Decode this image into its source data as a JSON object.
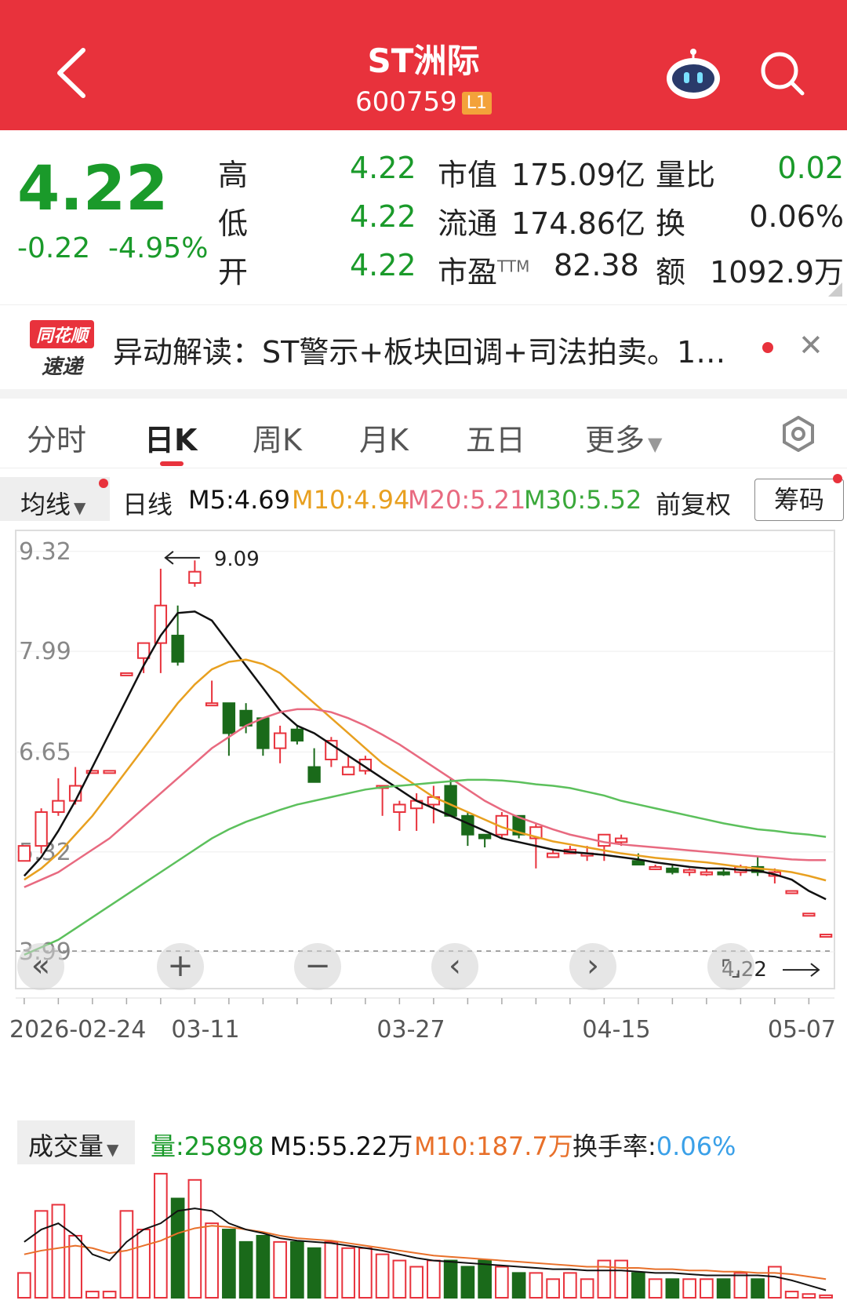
{
  "header": {
    "title": "ST洲际",
    "code": "600759",
    "level": "L1"
  },
  "quote": {
    "price": "4.22",
    "change": "-0.22",
    "change_pct": "-4.95%",
    "rows": [
      {
        "l1": "高",
        "v1": "4.22",
        "l2": "市值",
        "v2": "175.09亿",
        "l3": "量比",
        "v3": "0.02"
      },
      {
        "l1": "低",
        "v1": "4.22",
        "l2": "流通",
        "v2": "174.86亿",
        "l3": "换",
        "v3": "0.06%"
      },
      {
        "l1": "开",
        "v1": "4.22",
        "l2": "市盈TTM",
        "v2": "82.38",
        "l3": "额",
        "v3": "1092.9万"
      }
    ]
  },
  "alert": {
    "logo_top": "同花顺",
    "logo_bottom": "速递",
    "text": "异动解读：ST警示+板块回调+司法拍卖。1…"
  },
  "tabs": [
    "分时",
    "日K",
    "周K",
    "月K",
    "五日",
    "更多"
  ],
  "ma_bar": {
    "selector": "均线",
    "line": "日线",
    "m5": "M5:4.69",
    "m10": "M10:4.94",
    "m20": "M20:5.21",
    "m30": "M30:5.52",
    "adjust": "前复权",
    "chips": "筹码"
  },
  "colors": {
    "up": "#e8323c",
    "down": "#1a6a1a",
    "ma5": "#111111",
    "ma10": "#e8a020",
    "ma20": "#e86a80",
    "ma30": "#5cc05c",
    "brand": "#e8323c",
    "ratio": "#3aa0e8"
  },
  "chart_data": {
    "type": "candlestick",
    "y_ticks": [
      "9.32",
      "7.99",
      "6.65",
      "5.32",
      "3.99"
    ],
    "x_labels": [
      "2026-02-24",
      "03-11",
      "03-27",
      "04-15",
      "05-07"
    ],
    "high_label": "9.09",
    "low_label": "4.22",
    "ylim": [
      3.5,
      9.6
    ],
    "candles": [
      [
        5.2,
        5.4,
        5.2,
        5.4
      ],
      [
        5.4,
        5.9,
        5.3,
        5.85
      ],
      [
        5.85,
        6.3,
        5.8,
        6.0
      ],
      [
        6.0,
        6.45,
        5.95,
        6.2
      ],
      [
        6.4,
        6.4,
        6.4,
        6.4
      ],
      [
        6.4,
        6.4,
        6.4,
        6.4
      ],
      [
        7.7,
        7.7,
        7.7,
        7.7
      ],
      [
        7.9,
        8.1,
        7.7,
        8.1
      ],
      [
        8.1,
        9.09,
        7.7,
        8.6
      ],
      [
        8.2,
        8.6,
        7.8,
        7.85
      ],
      [
        8.9,
        9.2,
        8.85,
        9.05
      ],
      [
        7.3,
        7.6,
        7.3,
        7.3
      ],
      [
        7.3,
        7.3,
        6.6,
        6.9
      ],
      [
        7.2,
        7.3,
        6.9,
        7.0
      ],
      [
        7.1,
        7.1,
        6.6,
        6.7
      ],
      [
        6.7,
        7.0,
        6.5,
        6.9
      ],
      [
        6.95,
        7.0,
        6.75,
        6.8
      ],
      [
        6.45,
        6.7,
        6.35,
        6.25
      ],
      [
        6.55,
        6.85,
        6.45,
        6.8
      ],
      [
        6.35,
        6.6,
        6.4,
        6.45
      ],
      [
        6.4,
        6.6,
        6.35,
        6.55
      ],
      [
        6.2,
        6.2,
        5.8,
        6.2
      ],
      [
        5.85,
        6.0,
        5.6,
        5.95
      ],
      [
        5.9,
        6.1,
        5.6,
        6.0
      ],
      [
        5.95,
        6.2,
        5.7,
        6.05
      ],
      [
        6.2,
        6.3,
        5.85,
        5.8
      ],
      [
        5.8,
        5.85,
        5.4,
        5.55
      ],
      [
        5.55,
        5.5,
        5.38,
        5.5
      ],
      [
        5.55,
        5.85,
        5.5,
        5.8
      ],
      [
        5.8,
        5.8,
        5.5,
        5.55
      ],
      [
        5.5,
        5.7,
        5.1,
        5.65
      ],
      [
        5.25,
        5.35,
        5.3,
        5.3
      ],
      [
        5.3,
        5.4,
        5.3,
        5.35
      ],
      [
        5.3,
        5.4,
        5.2,
        5.3
      ],
      [
        5.4,
        5.55,
        5.2,
        5.55
      ],
      [
        5.45,
        5.55,
        5.4,
        5.5
      ],
      [
        5.2,
        5.3,
        5.15,
        5.15
      ],
      [
        5.1,
        5.15,
        5.08,
        5.12
      ],
      [
        5.1,
        5.15,
        5.02,
        5.05
      ],
      [
        5.05,
        5.1,
        5.0,
        5.08
      ],
      [
        5.05,
        5.1,
        5.0,
        5.05
      ],
      [
        5.05,
        5.1,
        5.0,
        5.02
      ],
      [
        5.05,
        5.15,
        5.0,
        5.12
      ],
      [
        5.12,
        5.25,
        5.0,
        5.05
      ],
      [
        5.0,
        5.1,
        4.9,
        5.05
      ],
      [
        4.8,
        4.8,
        4.8,
        4.8
      ],
      [
        4.5,
        4.5,
        4.5,
        4.5
      ],
      [
        4.22,
        4.22,
        4.22,
        4.22
      ]
    ],
    "series": [
      {
        "name": "M5",
        "values": [
          5.0,
          5.25,
          5.6,
          6.0,
          6.45,
          6.9,
          7.35,
          7.8,
          8.2,
          8.5,
          8.52,
          8.4,
          8.1,
          7.8,
          7.5,
          7.2,
          7.0,
          6.9,
          6.75,
          6.6,
          6.45,
          6.3,
          6.15,
          6.0,
          5.9,
          5.8,
          5.7,
          5.6,
          5.5,
          5.45,
          5.4,
          5.35,
          5.32,
          5.3,
          5.28,
          5.25,
          5.22,
          5.18,
          5.15,
          5.12,
          5.1,
          5.1,
          5.08,
          5.07,
          5.02,
          4.95,
          4.8,
          4.69
        ]
      },
      {
        "name": "M10",
        "values": [
          4.95,
          5.1,
          5.3,
          5.55,
          5.8,
          6.1,
          6.4,
          6.7,
          7.0,
          7.3,
          7.55,
          7.75,
          7.85,
          7.88,
          7.82,
          7.7,
          7.5,
          7.3,
          7.1,
          6.9,
          6.7,
          6.5,
          6.35,
          6.2,
          6.05,
          5.95,
          5.85,
          5.75,
          5.65,
          5.58,
          5.52,
          5.46,
          5.42,
          5.38,
          5.34,
          5.3,
          5.27,
          5.24,
          5.22,
          5.2,
          5.18,
          5.15,
          5.12,
          5.1,
          5.08,
          5.05,
          5.0,
          4.94
        ]
      },
      {
        "name": "M20",
        "values": [
          4.85,
          4.95,
          5.05,
          5.2,
          5.35,
          5.5,
          5.7,
          5.9,
          6.1,
          6.3,
          6.5,
          6.7,
          6.85,
          7.0,
          7.1,
          7.18,
          7.22,
          7.22,
          7.18,
          7.1,
          7.0,
          6.88,
          6.75,
          6.6,
          6.45,
          6.3,
          6.15,
          6.0,
          5.88,
          5.78,
          5.7,
          5.62,
          5.55,
          5.5,
          5.45,
          5.42,
          5.4,
          5.38,
          5.36,
          5.34,
          5.32,
          5.3,
          5.28,
          5.26,
          5.24,
          5.22,
          5.21,
          5.21
        ]
      },
      {
        "name": "M30",
        "values": [
          3.95,
          4.05,
          4.15,
          4.3,
          4.45,
          4.6,
          4.75,
          4.9,
          5.05,
          5.2,
          5.35,
          5.5,
          5.62,
          5.72,
          5.8,
          5.88,
          5.95,
          6.0,
          6.05,
          6.1,
          6.15,
          6.18,
          6.2,
          6.22,
          6.24,
          6.26,
          6.28,
          6.28,
          6.27,
          6.25,
          6.22,
          6.2,
          6.17,
          6.12,
          6.07,
          6.0,
          5.95,
          5.9,
          5.85,
          5.8,
          5.75,
          5.7,
          5.66,
          5.62,
          5.6,
          5.57,
          5.55,
          5.52
        ]
      }
    ]
  },
  "volume": {
    "selector": "成交量",
    "vol": "量:25898",
    "m5": "M5:55.22万",
    "m10": "M10:187.7万",
    "turnover_label": "换手率:",
    "turnover": "0.06%",
    "bars": [
      20,
      70,
      75,
      50,
      5,
      5,
      70,
      55,
      100,
      80,
      95,
      60,
      55,
      45,
      50,
      45,
      45,
      40,
      45,
      40,
      40,
      35,
      30,
      25,
      30,
      30,
      25,
      30,
      25,
      20,
      20,
      15,
      20,
      15,
      30,
      30,
      20,
      15,
      15,
      15,
      15,
      15,
      20,
      15,
      25,
      5,
      3,
      2
    ],
    "ma5": [
      45,
      55,
      60,
      50,
      35,
      30,
      45,
      55,
      60,
      70,
      72,
      70,
      60,
      55,
      52,
      48,
      46,
      45,
      44,
      42,
      40,
      38,
      35,
      32,
      30,
      29,
      28,
      27,
      26,
      25,
      24,
      23,
      23,
      22,
      22,
      22,
      21,
      20,
      20,
      19,
      18,
      18,
      18,
      18,
      17,
      14,
      10,
      6
    ],
    "ma10": [
      35,
      38,
      40,
      42,
      40,
      36,
      38,
      42,
      46,
      52,
      56,
      58,
      57,
      55,
      53,
      50,
      48,
      47,
      46,
      44,
      42,
      40,
      38,
      36,
      34,
      33,
      32,
      31,
      30,
      29,
      28,
      27,
      26,
      25,
      25,
      24,
      24,
      23,
      23,
      22,
      22,
      21,
      21,
      20,
      20,
      19,
      17,
      15
    ]
  }
}
